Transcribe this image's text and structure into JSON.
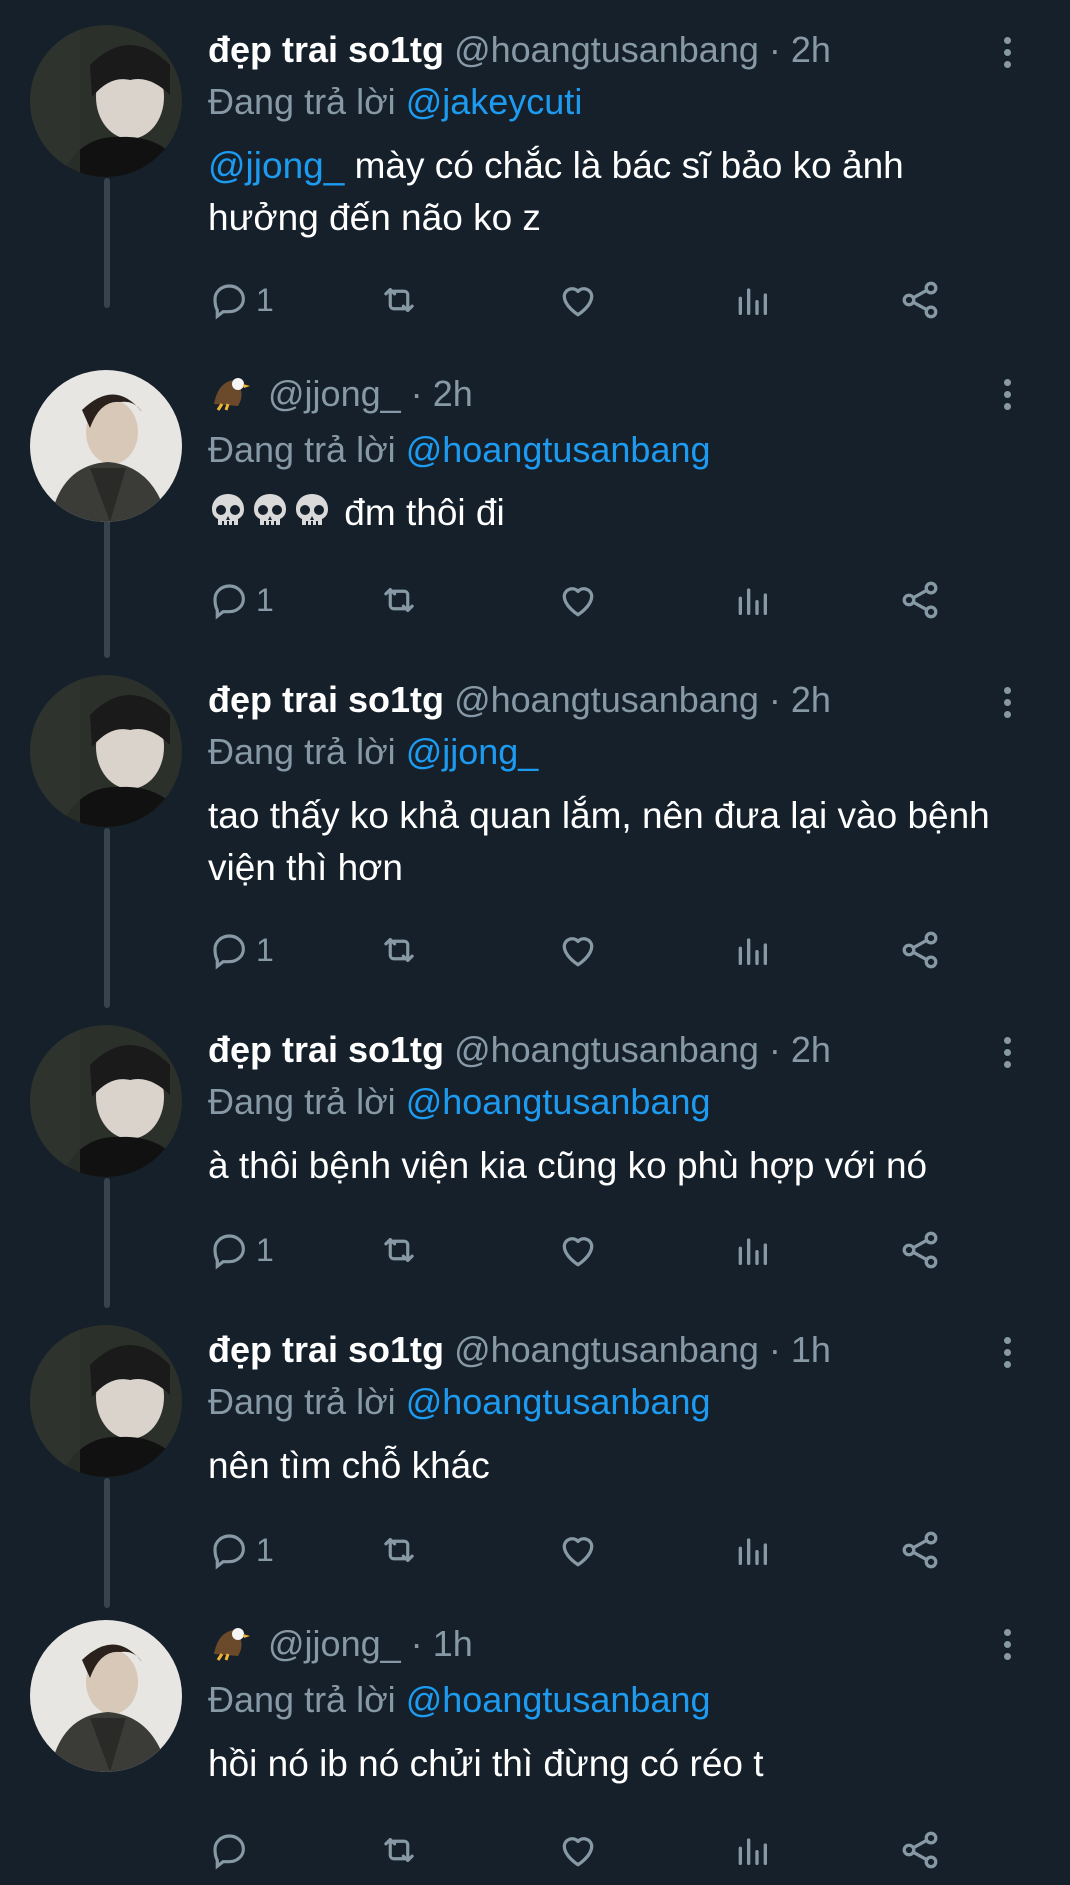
{
  "thread": [
    {
      "display_name": "đẹp trai so1tg",
      "handle": "@hoangtusanbang",
      "separator": "·",
      "time": "2h",
      "reply_prefix": "Đang trả lời",
      "reply_to": "@jakeycuti",
      "mention": "@jjong_",
      "text": " mày có chắc là bác sĩ bảo ko ảnh hưởng đến não ko z",
      "reply_count": "1",
      "avatar": "avatar-hoang"
    },
    {
      "display_name": "",
      "handle": "@jjong_",
      "separator": "·",
      "time": "2h",
      "reply_prefix": "Đang trả lời",
      "reply_to": "@hoangtusanbang",
      "mention": "",
      "text": " đm thôi đi",
      "reply_count": "1",
      "avatar": "avatar-jjong"
    },
    {
      "display_name": "đẹp trai so1tg",
      "handle": "@hoangtusanbang",
      "separator": "·",
      "time": "2h",
      "reply_prefix": "Đang trả lời",
      "reply_to": "@jjong_",
      "mention": "",
      "text": "tao thấy ko khả quan lắm, nên đưa lại vào bệnh viện thì hơn",
      "reply_count": "1",
      "avatar": "avatar-hoang"
    },
    {
      "display_name": "đẹp trai so1tg",
      "handle": "@hoangtusanbang",
      "separator": "·",
      "time": "2h",
      "reply_prefix": "Đang trả lời",
      "reply_to": "@hoangtusanbang",
      "mention": "",
      "text": "à thôi bệnh viện kia cũng ko phù hợp với nó",
      "reply_count": "1",
      "avatar": "avatar-hoang"
    },
    {
      "display_name": "đẹp trai so1tg",
      "handle": "@hoangtusanbang",
      "separator": "·",
      "time": "1h",
      "reply_prefix": "Đang trả lời",
      "reply_to": "@hoangtusanbang",
      "mention": "",
      "text": "nên tìm chỗ khác",
      "reply_count": "1",
      "avatar": "avatar-hoang"
    },
    {
      "display_name": "",
      "handle": "@jjong_",
      "separator": "·",
      "time": "1h",
      "reply_prefix": "Đang trả lời",
      "reply_to": "@hoangtusanbang",
      "mention": "",
      "text": "hồi nó ib nó chửi thì đừng có réo t",
      "reply_count": "",
      "avatar": "avatar-jjong"
    }
  ],
  "colors": {
    "background": "#15202b",
    "text": "#ffffff",
    "muted": "#8899a6",
    "link": "#1d9bf0",
    "thread_line": "#38444d"
  },
  "icons": [
    "reply-icon",
    "retweet-icon",
    "like-icon",
    "views-icon",
    "share-icon",
    "more-icon",
    "eagle-emoji",
    "skull-emoji"
  ]
}
